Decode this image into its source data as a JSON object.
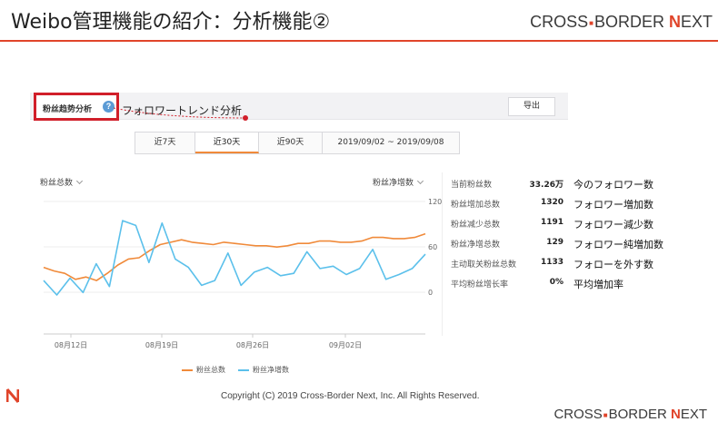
{
  "slide": {
    "title": "Weibo管理機能の紹介：分析機能②",
    "brand": {
      "part1": "CROSS",
      "sep": "■",
      "part2": "BORDER ",
      "n": "N",
      "ext": "EXT"
    },
    "copyright": "Copyright (C) 2019 Cross-Border Next, Inc. All Rights Reserved.",
    "accent_color": "#e0442a"
  },
  "panel": {
    "tab_label": "粉丝趋势分析",
    "help_icon": "?",
    "annotation_trend": "フォロワートレンド分析",
    "export_label": "导出",
    "ranges": [
      "近7天",
      "近30天",
      "近90天",
      "2019/09/02 ~ 2019/09/08"
    ],
    "active_range_index": 1
  },
  "chart_data": {
    "type": "line",
    "left_axis_label": "粉丝总数",
    "right_axis_label": "粉丝净增数",
    "right_ticks": [
      "120",
      "60",
      "0"
    ],
    "x_ticks": [
      "08月12日",
      "08月19日",
      "08月26日",
      "09月02日"
    ],
    "series": [
      {
        "name": "粉丝总数",
        "color": "#f08a3a",
        "values": [
          0.45,
          0.42,
          0.4,
          0.35,
          0.37,
          0.34,
          0.4,
          0.47,
          0.52,
          0.53,
          0.59,
          0.64,
          0.66,
          0.68,
          0.66,
          0.65,
          0.64,
          0.66,
          0.65,
          0.64,
          0.63,
          0.63,
          0.62,
          0.63,
          0.65,
          0.65,
          0.67,
          0.67,
          0.66,
          0.66,
          0.67,
          0.7,
          0.7,
          0.69,
          0.69,
          0.7,
          0.73
        ]
      },
      {
        "name": "粉丝净增数",
        "color": "#5bc0eb",
        "values": [
          0.34,
          0.22,
          0.36,
          0.24,
          0.48,
          0.29,
          0.84,
          0.8,
          0.49,
          0.82,
          0.52,
          0.45,
          0.3,
          0.34,
          0.57,
          0.3,
          0.41,
          0.45,
          0.38,
          0.4,
          0.58,
          0.44,
          0.46,
          0.39,
          0.44,
          0.6,
          0.35,
          0.39,
          0.44,
          0.56
        ]
      }
    ]
  },
  "stats": [
    {
      "label": "当前粉丝数",
      "value": "33.26万",
      "annotation": "今のフォロワー数"
    },
    {
      "label": "粉丝增加总数",
      "value": "1320",
      "annotation": "フォロワー増加数"
    },
    {
      "label": "粉丝减少总数",
      "value": "1191",
      "annotation": "フォロワー減少数"
    },
    {
      "label": "粉丝净增总数",
      "value": "129",
      "annotation": "フォロワー純増加数"
    },
    {
      "label": "主动取关粉丝总数",
      "value": "1133",
      "annotation": "フォローを外す数"
    },
    {
      "label": "平均粉丝增长率",
      "value": "0%",
      "annotation": "平均増加率"
    }
  ]
}
